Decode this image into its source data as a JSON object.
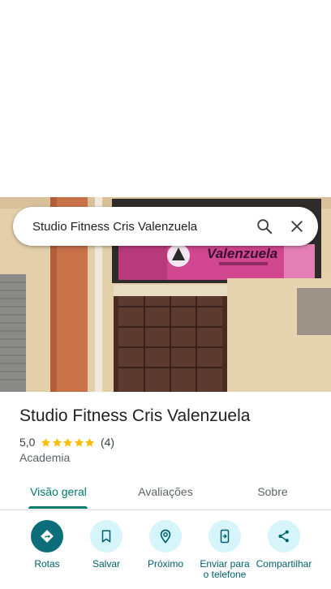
{
  "search": {
    "query": "Studio Fitness Cris Valenzuela",
    "search_icon": "search-icon",
    "close_icon": "close-icon"
  },
  "photo": {
    "banner_name": "Valenzuela",
    "banner_sub": "Cris Valenzuela"
  },
  "place": {
    "name": "Studio Fitness Cris Valenzuela",
    "rating": "5,0",
    "rating_value": 5,
    "review_count": "(4)",
    "category": "Academia"
  },
  "tabs": [
    {
      "label": "Visão geral",
      "active": true
    },
    {
      "label": "Avaliações",
      "active": false
    },
    {
      "label": "Sobre",
      "active": false
    }
  ],
  "actions": [
    {
      "label": "Rotas",
      "icon": "directions-icon"
    },
    {
      "label": "Salvar",
      "icon": "bookmark-icon"
    },
    {
      "label": "Próximo",
      "icon": "nearby-icon"
    },
    {
      "label": "Enviar para o telefone",
      "icon": "send-to-phone-icon"
    },
    {
      "label": "Compartilhar",
      "icon": "share-icon"
    }
  ],
  "colors": {
    "accent": "#00796b",
    "primary_action": "#0b6e7a",
    "action_bg": "#d5f5fb",
    "star": "#fbbc04"
  }
}
